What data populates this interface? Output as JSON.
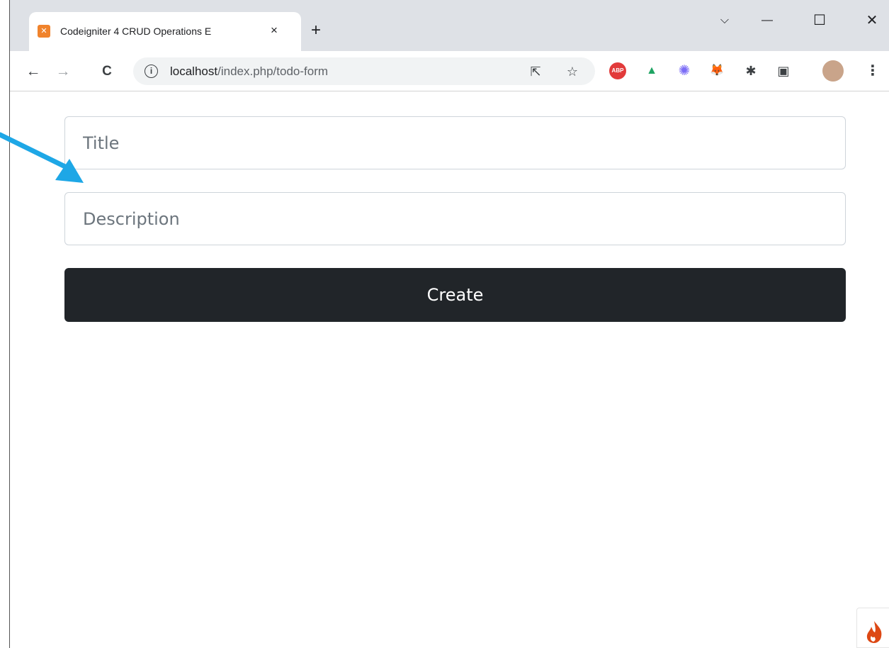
{
  "browser": {
    "tab_title": "Codeigniter 4 CRUD Operations E",
    "tab_favicon": "xampp-icon",
    "close_tab_icon": "×",
    "new_tab_icon": "+",
    "window_controls": {
      "dropdown": "⌵",
      "minimize": "—",
      "maximize": "☐",
      "close": "✕"
    },
    "nav": {
      "back": "←",
      "forward": "→",
      "reload": "C"
    },
    "address": {
      "host": "localhost",
      "path": "/index.php/todo-form"
    },
    "omnibox_icons": {
      "share": "⇱",
      "bookmark": "☆"
    },
    "extensions": [
      {
        "name": "adblock-plus-icon",
        "label": "ABP",
        "color": "#e23a3a"
      },
      {
        "name": "google-drive-icon",
        "label": "▲",
        "color": "#1fa463"
      },
      {
        "name": "extension-star-icon",
        "label": "✺",
        "color": "#7b6cf6"
      },
      {
        "name": "metamask-icon",
        "label": "🦊",
        "color": "#f6851b"
      },
      {
        "name": "extensions-puzzle-icon",
        "label": "✱",
        "color": "#3c4043"
      },
      {
        "name": "side-panel-icon",
        "label": "▣",
        "color": "#3c4043"
      }
    ],
    "menu_icon": "⋮"
  },
  "form": {
    "title_placeholder": "Title",
    "description_placeholder": "Description",
    "create_label": "Create"
  },
  "colors": {
    "button_bg": "#212529",
    "arrow": "#1ea7e6",
    "ci_flame": "#dd4814"
  }
}
